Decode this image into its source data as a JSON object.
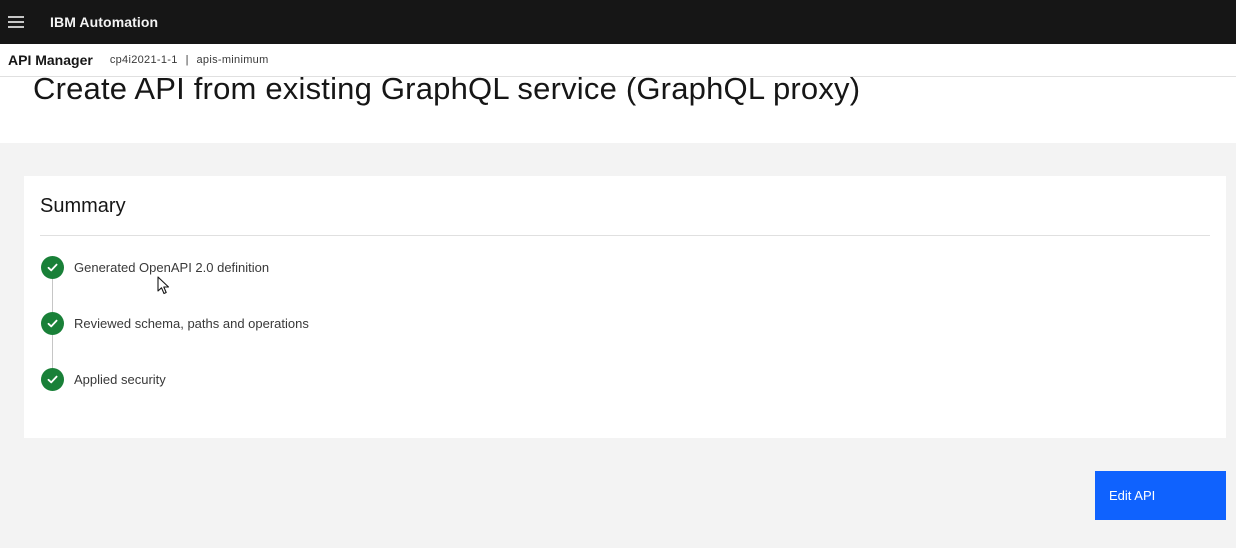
{
  "topbar": {
    "menu_icon": "hamburger-menu-icon",
    "brand": "IBM Automation"
  },
  "subheader": {
    "app_name": "API Manager",
    "breadcrumb": [
      "cp4i2021-1-1",
      "apis-minimum"
    ],
    "separator": "|"
  },
  "page": {
    "title": "Create API from existing GraphQL service (GraphQL proxy)"
  },
  "summary": {
    "title": "Summary",
    "steps": [
      {
        "label": "Generated OpenAPI 2.0 definition",
        "status": "complete",
        "icon": "checkmark-circle-icon"
      },
      {
        "label": "Reviewed schema, paths and operations",
        "status": "complete",
        "icon": "checkmark-circle-icon"
      },
      {
        "label": "Applied security",
        "status": "complete",
        "icon": "checkmark-circle-icon"
      }
    ]
  },
  "actions": {
    "edit_label": "Edit API"
  },
  "colors": {
    "topbar": "#161616",
    "success": "#198038",
    "primary": "#0f62fe"
  }
}
